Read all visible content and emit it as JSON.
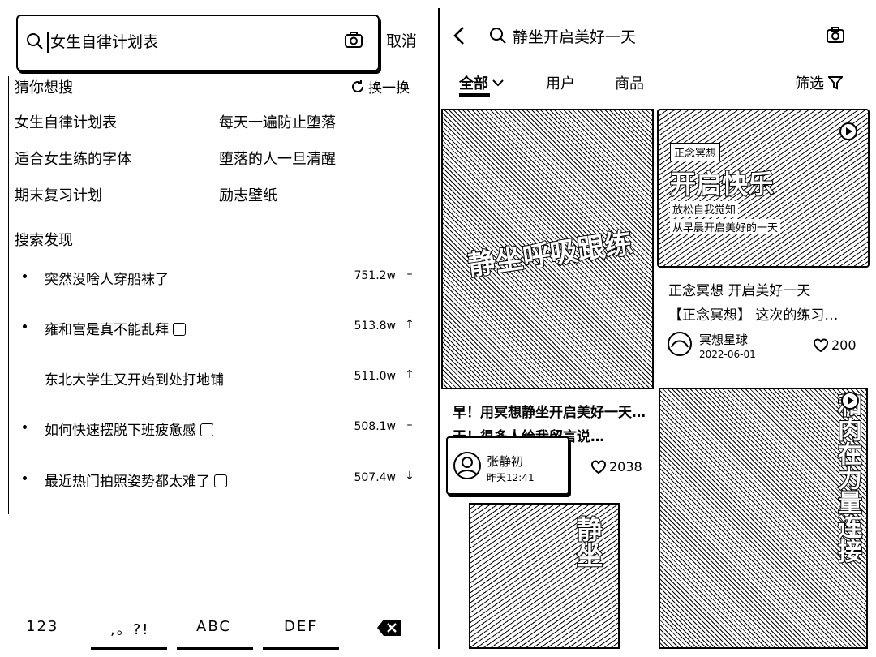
{
  "left": {
    "search": {
      "query": "女生自律计划表"
    },
    "cancel_label": "取消",
    "guess": {
      "title": "猜你想搜",
      "refresh_label": "换一换",
      "items": [
        "女生自律计划表",
        "每天一遍防止堕落",
        "适合女生练的字体",
        "堕落的人一旦清醒",
        "期末复习计划",
        "励志壁纸"
      ]
    },
    "discover": {
      "title": "搜索发现",
      "items": [
        {
          "label": "突然没啥人穿船袜了",
          "count": "751.2w",
          "trend": "–",
          "tag": false
        },
        {
          "label": "雍和宫是真不能乱拜",
          "count": "513.8w",
          "trend": "↑",
          "tag": true
        },
        {
          "label": "东北大学生又开始到处打地铺",
          "count": "511.0w",
          "trend": "↑",
          "tag": false
        },
        {
          "label": "如何快速摆脱下班疲惫感",
          "count": "508.1w",
          "trend": "–",
          "tag": true
        },
        {
          "label": "最近热门拍照姿势都太难了",
          "count": "507.4w",
          "trend": "↓",
          "tag": true
        }
      ]
    },
    "keyboard": {
      "keys": [
        "123",
        ",。?!",
        "ABC",
        "DEF"
      ]
    }
  },
  "right": {
    "search": {
      "query": "静坐开启美好一天"
    },
    "tabs": [
      "全部",
      "用户",
      "商品"
    ],
    "filter_label": "筛选",
    "cards": [
      {
        "overlay": "静坐呼吸跟练",
        "title": "早！用冥想静坐开启美好一天…",
        "subtitle": "天！很多人给我留言说…",
        "author": "张静初",
        "time": "昨天12:41",
        "likes": "2038"
      },
      {
        "badge": "正念冥想",
        "overlay": "开启快乐",
        "line1": "放松自我觉知",
        "line2": "从早晨开启美好的一天",
        "title": "正念冥想 开启美好一天",
        "subtitle": "【正念冥想】 这次的练习…",
        "author": "冥想星球",
        "time": "2022-06-01",
        "likes": "200"
      },
      {
        "overlay": "静坐"
      },
      {
        "overlay": "和肉在力量连接"
      }
    ]
  }
}
